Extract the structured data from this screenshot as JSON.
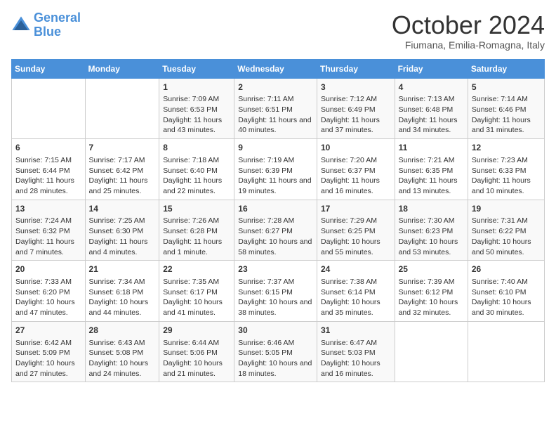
{
  "header": {
    "logo_line1": "General",
    "logo_line2": "Blue",
    "month_title": "October 2024",
    "location": "Fiumana, Emilia-Romagna, Italy"
  },
  "weekdays": [
    "Sunday",
    "Monday",
    "Tuesday",
    "Wednesday",
    "Thursday",
    "Friday",
    "Saturday"
  ],
  "weeks": [
    [
      {
        "day": "",
        "content": ""
      },
      {
        "day": "",
        "content": ""
      },
      {
        "day": "1",
        "content": "Sunrise: 7:09 AM\nSunset: 6:53 PM\nDaylight: 11 hours and 43 minutes."
      },
      {
        "day": "2",
        "content": "Sunrise: 7:11 AM\nSunset: 6:51 PM\nDaylight: 11 hours and 40 minutes."
      },
      {
        "day": "3",
        "content": "Sunrise: 7:12 AM\nSunset: 6:49 PM\nDaylight: 11 hours and 37 minutes."
      },
      {
        "day": "4",
        "content": "Sunrise: 7:13 AM\nSunset: 6:48 PM\nDaylight: 11 hours and 34 minutes."
      },
      {
        "day": "5",
        "content": "Sunrise: 7:14 AM\nSunset: 6:46 PM\nDaylight: 11 hours and 31 minutes."
      }
    ],
    [
      {
        "day": "6",
        "content": "Sunrise: 7:15 AM\nSunset: 6:44 PM\nDaylight: 11 hours and 28 minutes."
      },
      {
        "day": "7",
        "content": "Sunrise: 7:17 AM\nSunset: 6:42 PM\nDaylight: 11 hours and 25 minutes."
      },
      {
        "day": "8",
        "content": "Sunrise: 7:18 AM\nSunset: 6:40 PM\nDaylight: 11 hours and 22 minutes."
      },
      {
        "day": "9",
        "content": "Sunrise: 7:19 AM\nSunset: 6:39 PM\nDaylight: 11 hours and 19 minutes."
      },
      {
        "day": "10",
        "content": "Sunrise: 7:20 AM\nSunset: 6:37 PM\nDaylight: 11 hours and 16 minutes."
      },
      {
        "day": "11",
        "content": "Sunrise: 7:21 AM\nSunset: 6:35 PM\nDaylight: 11 hours and 13 minutes."
      },
      {
        "day": "12",
        "content": "Sunrise: 7:23 AM\nSunset: 6:33 PM\nDaylight: 11 hours and 10 minutes."
      }
    ],
    [
      {
        "day": "13",
        "content": "Sunrise: 7:24 AM\nSunset: 6:32 PM\nDaylight: 11 hours and 7 minutes."
      },
      {
        "day": "14",
        "content": "Sunrise: 7:25 AM\nSunset: 6:30 PM\nDaylight: 11 hours and 4 minutes."
      },
      {
        "day": "15",
        "content": "Sunrise: 7:26 AM\nSunset: 6:28 PM\nDaylight: 11 hours and 1 minute."
      },
      {
        "day": "16",
        "content": "Sunrise: 7:28 AM\nSunset: 6:27 PM\nDaylight: 10 hours and 58 minutes."
      },
      {
        "day": "17",
        "content": "Sunrise: 7:29 AM\nSunset: 6:25 PM\nDaylight: 10 hours and 55 minutes."
      },
      {
        "day": "18",
        "content": "Sunrise: 7:30 AM\nSunset: 6:23 PM\nDaylight: 10 hours and 53 minutes."
      },
      {
        "day": "19",
        "content": "Sunrise: 7:31 AM\nSunset: 6:22 PM\nDaylight: 10 hours and 50 minutes."
      }
    ],
    [
      {
        "day": "20",
        "content": "Sunrise: 7:33 AM\nSunset: 6:20 PM\nDaylight: 10 hours and 47 minutes."
      },
      {
        "day": "21",
        "content": "Sunrise: 7:34 AM\nSunset: 6:18 PM\nDaylight: 10 hours and 44 minutes."
      },
      {
        "day": "22",
        "content": "Sunrise: 7:35 AM\nSunset: 6:17 PM\nDaylight: 10 hours and 41 minutes."
      },
      {
        "day": "23",
        "content": "Sunrise: 7:37 AM\nSunset: 6:15 PM\nDaylight: 10 hours and 38 minutes."
      },
      {
        "day": "24",
        "content": "Sunrise: 7:38 AM\nSunset: 6:14 PM\nDaylight: 10 hours and 35 minutes."
      },
      {
        "day": "25",
        "content": "Sunrise: 7:39 AM\nSunset: 6:12 PM\nDaylight: 10 hours and 32 minutes."
      },
      {
        "day": "26",
        "content": "Sunrise: 7:40 AM\nSunset: 6:10 PM\nDaylight: 10 hours and 30 minutes."
      }
    ],
    [
      {
        "day": "27",
        "content": "Sunrise: 6:42 AM\nSunset: 5:09 PM\nDaylight: 10 hours and 27 minutes."
      },
      {
        "day": "28",
        "content": "Sunrise: 6:43 AM\nSunset: 5:08 PM\nDaylight: 10 hours and 24 minutes."
      },
      {
        "day": "29",
        "content": "Sunrise: 6:44 AM\nSunset: 5:06 PM\nDaylight: 10 hours and 21 minutes."
      },
      {
        "day": "30",
        "content": "Sunrise: 6:46 AM\nSunset: 5:05 PM\nDaylight: 10 hours and 18 minutes."
      },
      {
        "day": "31",
        "content": "Sunrise: 6:47 AM\nSunset: 5:03 PM\nDaylight: 10 hours and 16 minutes."
      },
      {
        "day": "",
        "content": ""
      },
      {
        "day": "",
        "content": ""
      }
    ]
  ]
}
